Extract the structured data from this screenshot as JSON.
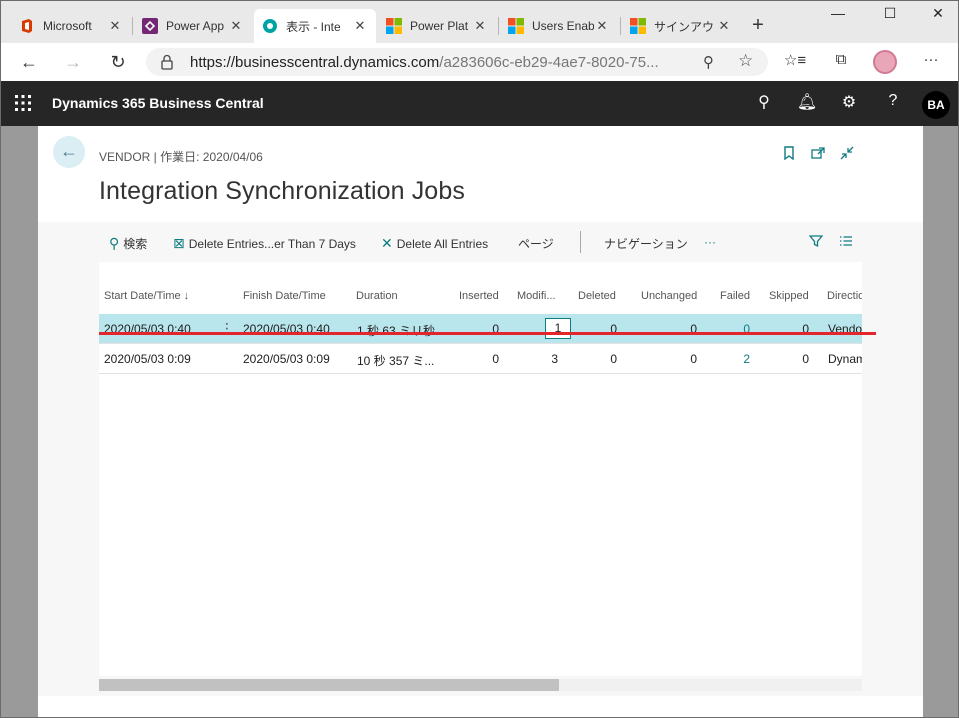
{
  "browser": {
    "tabs": [
      {
        "label": "Microsoft",
        "icon": "office-icon"
      },
      {
        "label": "Power App",
        "icon": "power-apps-icon"
      },
      {
        "label": "表示 - Inte",
        "icon": "business-central-icon"
      },
      {
        "label": "Power Plat",
        "icon": "microsoft-logo-icon"
      },
      {
        "label": "Users Enab",
        "icon": "microsoft-logo-icon"
      },
      {
        "label": "サインアウト",
        "icon": "microsoft-logo-icon"
      }
    ],
    "url_host": "https://businesscentral.dynamics.com",
    "url_rest": "/a283606c-eb29-4ae7-8020-75..."
  },
  "app": {
    "name": "Dynamics 365 Business Central",
    "avatar": "BA"
  },
  "page": {
    "caption": "VENDOR | 作業日: 2020/04/06",
    "title": "Integration Synchronization Jobs"
  },
  "actions": {
    "search": "検索",
    "delete_older": "Delete Entries...er Than 7 Days",
    "delete_all": "Delete All Entries",
    "page": "ページ",
    "navigation": "ナビゲーション",
    "more": "···"
  },
  "grid": {
    "headers": {
      "start": "Start Date/Time ↓",
      "finish": "Finish Date/Time",
      "duration": "Duration",
      "inserted": "Inserted",
      "modified": "Modifi...",
      "deleted": "Deleted",
      "unchanged": "Unchanged",
      "failed": "Failed",
      "skipped": "Skipped",
      "direction": "Directio"
    },
    "rows": [
      {
        "start": "2020/05/03 0:40",
        "finish": "2020/05/03 0:40",
        "duration": "1 秒 63 ミリ秒",
        "inserted": "0",
        "modified": "1",
        "deleted": "0",
        "unchanged": "0",
        "failed": "0",
        "skipped": "0",
        "direction": "Vendo"
      },
      {
        "start": "2020/05/03 0:09",
        "finish": "2020/05/03 0:09",
        "duration": "10 秒 357 ミ...",
        "inserted": "0",
        "modified": "3",
        "deleted": "0",
        "unchanged": "0",
        "failed": "2",
        "skipped": "0",
        "direction": "Dynam"
      }
    ]
  },
  "colors": {
    "accent": "#0f7c82",
    "selected_row": "#b8e6ec",
    "header_bar": "#262626",
    "annotation_line": "#e2262c"
  }
}
